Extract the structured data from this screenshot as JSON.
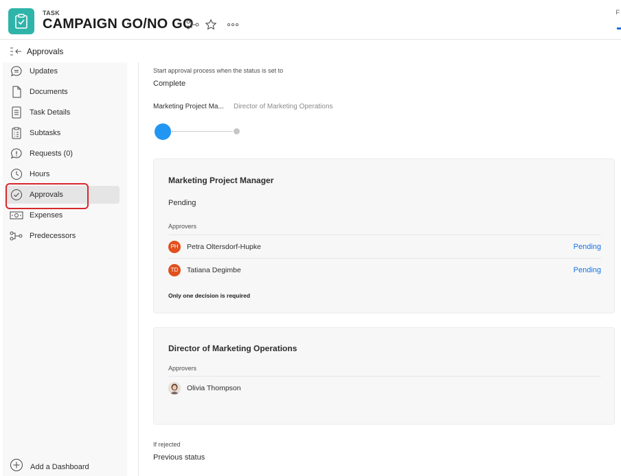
{
  "header": {
    "type_label": "TASK",
    "title": "CAMPAIGN GO/NO GO",
    "edge_tab_label": "F"
  },
  "breadcrumb": {
    "label": "Approvals"
  },
  "sidebar": {
    "items": [
      {
        "label": "Updates",
        "icon": "speech-bubble-icon"
      },
      {
        "label": "Documents",
        "icon": "document-icon"
      },
      {
        "label": "Task Details",
        "icon": "task-details-icon"
      },
      {
        "label": "Subtasks",
        "icon": "subtasks-icon"
      },
      {
        "label": "Requests (0)",
        "icon": "request-icon"
      },
      {
        "label": "Hours",
        "icon": "clock-icon"
      },
      {
        "label": "Approvals",
        "icon": "checkmark-circle-icon",
        "active": true
      },
      {
        "label": "Expenses",
        "icon": "money-icon"
      },
      {
        "label": "Predecessors",
        "icon": "predecessor-icon"
      }
    ],
    "add_dashboard": "Add a Dashboard"
  },
  "main": {
    "start_label": "Start approval process when the status is set to",
    "start_value": "Complete",
    "steps": [
      {
        "label": "Marketing Project Ma...",
        "active": true
      },
      {
        "label": "Director of Marketing Operations",
        "active": false
      }
    ],
    "stage1": {
      "title": "Marketing Project Manager",
      "status": "Pending",
      "approvers_label": "Approvers",
      "approvers": [
        {
          "initials": "PH",
          "name": "Petra Oltersdorf-Hupke",
          "status": "Pending"
        },
        {
          "initials": "TD",
          "name": "Tatiana Degimbe",
          "status": "Pending"
        }
      ],
      "note": "Only one decision is required"
    },
    "stage2": {
      "title": "Director of Marketing Operations",
      "approvers_label": "Approvers",
      "approvers": [
        {
          "name": "Olivia Thompson"
        }
      ]
    },
    "rejected_label": "If rejected",
    "rejected_value": "Previous status"
  },
  "colors": {
    "accent": "#1473e6",
    "task_icon_bg": "#2fb4a9",
    "avatar_bg": "#e1501d",
    "highlight": "#d7262c",
    "step_active": "#2196f3"
  }
}
